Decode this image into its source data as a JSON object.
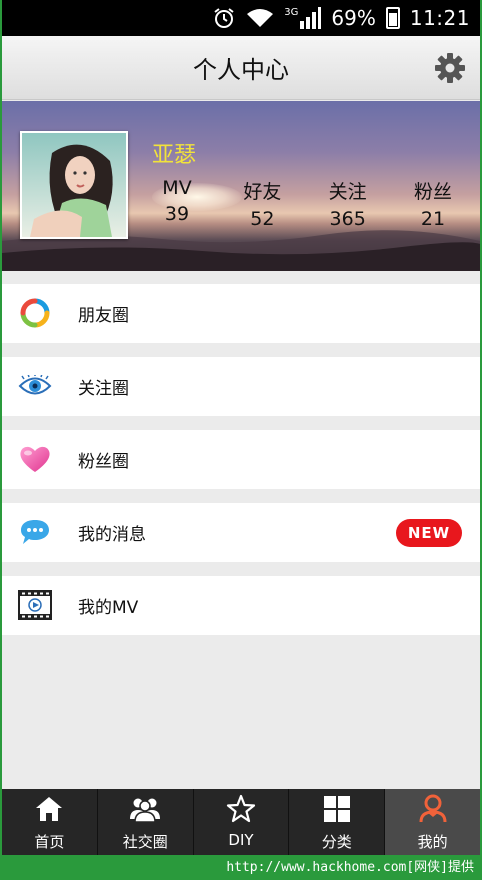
{
  "status_bar": {
    "network": "3G",
    "battery": "69%",
    "time": "11:21",
    "icons": [
      "alarm-icon",
      "wifi-icon",
      "signal-icon",
      "battery-icon"
    ]
  },
  "header": {
    "title": "个人中心",
    "settings_icon": "gear-icon"
  },
  "profile": {
    "username": "亚瑟",
    "avatar": "avatar-photo",
    "stats": [
      {
        "label": "MV",
        "value": "39"
      },
      {
        "label": "好友",
        "value": "52"
      },
      {
        "label": "关注",
        "value": "365"
      },
      {
        "label": "粉丝",
        "value": "21"
      }
    ]
  },
  "menu": {
    "items": [
      {
        "label": "朋友圈",
        "icon": "friends-circle-icon"
      },
      {
        "label": "关注圈",
        "icon": "eye-icon"
      },
      {
        "label": "粉丝圈",
        "icon": "heart-icon"
      },
      {
        "label": "我的消息",
        "icon": "chat-bubble-icon",
        "badge": "NEW"
      },
      {
        "label": "我的MV",
        "icon": "film-icon"
      }
    ]
  },
  "tab_bar": {
    "tabs": [
      {
        "label": "首页",
        "icon": "home-icon"
      },
      {
        "label": "社交圈",
        "icon": "people-icon"
      },
      {
        "label": "DIY",
        "icon": "star-icon"
      },
      {
        "label": "分类",
        "icon": "grid-icon"
      },
      {
        "label": "我的",
        "icon": "user-icon",
        "active": true
      }
    ]
  },
  "footer": {
    "watermark": "http://www.hackhome.com[网侠]提供"
  },
  "colors": {
    "username": "#f2e33a",
    "badge": "#e8171d",
    "tab_bar": "#262626",
    "active_tab": "#4a4a4a",
    "user_icon": "#f0623a"
  }
}
